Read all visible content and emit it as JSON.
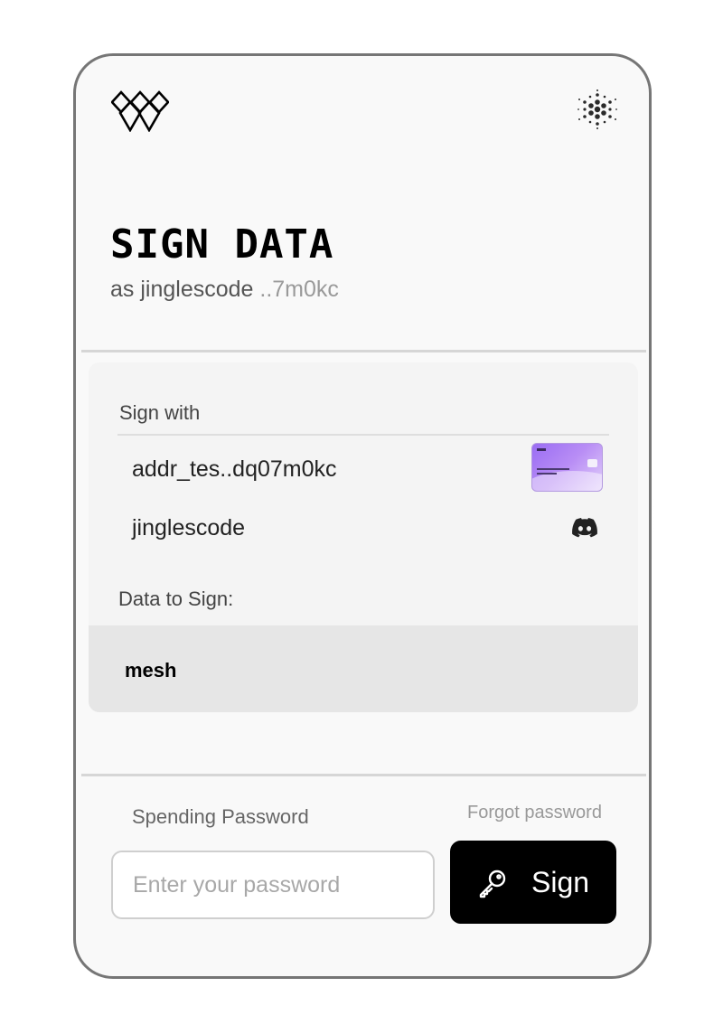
{
  "header": {
    "logo_icon": "mesh-diamond-logo-icon",
    "network_icon": "cardano-icon",
    "title": "SIGN DATA",
    "subtitle_prefix": "as jinglescode",
    "subtitle_address": " ..7m0kc"
  },
  "sign_with": {
    "label": "Sign with",
    "address": "addr_tes..dq07m0kc",
    "username": "jinglescode",
    "card_icon": "wallet-card-icon",
    "social_icon": "discord-icon"
  },
  "data": {
    "label": "Data to Sign:",
    "value": "mesh"
  },
  "password": {
    "label": "Spending Password",
    "forgot_label": "Forgot password",
    "placeholder": "Enter your password",
    "value": ""
  },
  "action": {
    "sign_label": "Sign",
    "icon": "key-icon"
  },
  "colors": {
    "card_background": "#f9f9f9",
    "button_background": "#000000",
    "wallet_card_accent": "#9a6df3"
  }
}
